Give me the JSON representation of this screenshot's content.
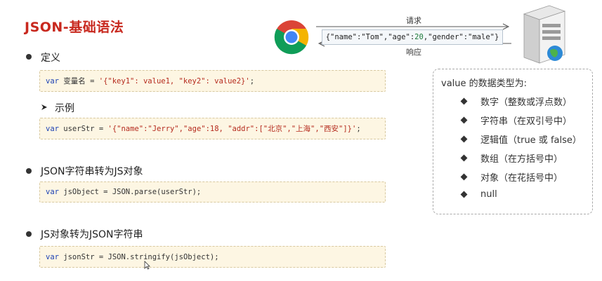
{
  "title": "JSON-基础语法",
  "sections": {
    "definition": {
      "label": "定义",
      "code": {
        "kw": "var",
        "name": " 变量名 = ",
        "str": "'{\"key1\": value1, \"key2\": value2}'",
        "end": ";"
      }
    },
    "example": {
      "label": "示例",
      "code": {
        "kw": "var",
        "name": " userStr = ",
        "str": "'{\"name\":\"Jerry\",\"age\":18, \"addr\":[\"北京\",\"上海\",\"西安\"]}'",
        "end": ";"
      }
    },
    "parse": {
      "label": "JSON字符串转为JS对象",
      "code": {
        "kw": "var",
        "rest": " jsObject = JSON.parse(userStr);"
      }
    },
    "stringify": {
      "label": "JS对象转为JSON字符串",
      "code": {
        "kw": "var",
        "rest": " jsonStr = JSON.stringify(jsObject);"
      }
    }
  },
  "diagram": {
    "request_label": "请求",
    "response_label": "响应",
    "json_pre": "{\"name\":\"Tom\",\"age\":",
    "json_num": "20",
    "json_post": ",\"gender\":\"male\"}"
  },
  "info": {
    "heading": "value 的数据类型为:",
    "items": [
      "数字（整数或浮点数）",
      "字符串（在双引号中）",
      "逻辑值（true 或 false）",
      "数组（在方括号中）",
      "对象（在花括号中）",
      "null"
    ]
  },
  "colors": {
    "title": "#c8281e",
    "code_bg": "#fdf6e3",
    "keyword": "#1a3fb3",
    "string": "#b52a1d"
  }
}
